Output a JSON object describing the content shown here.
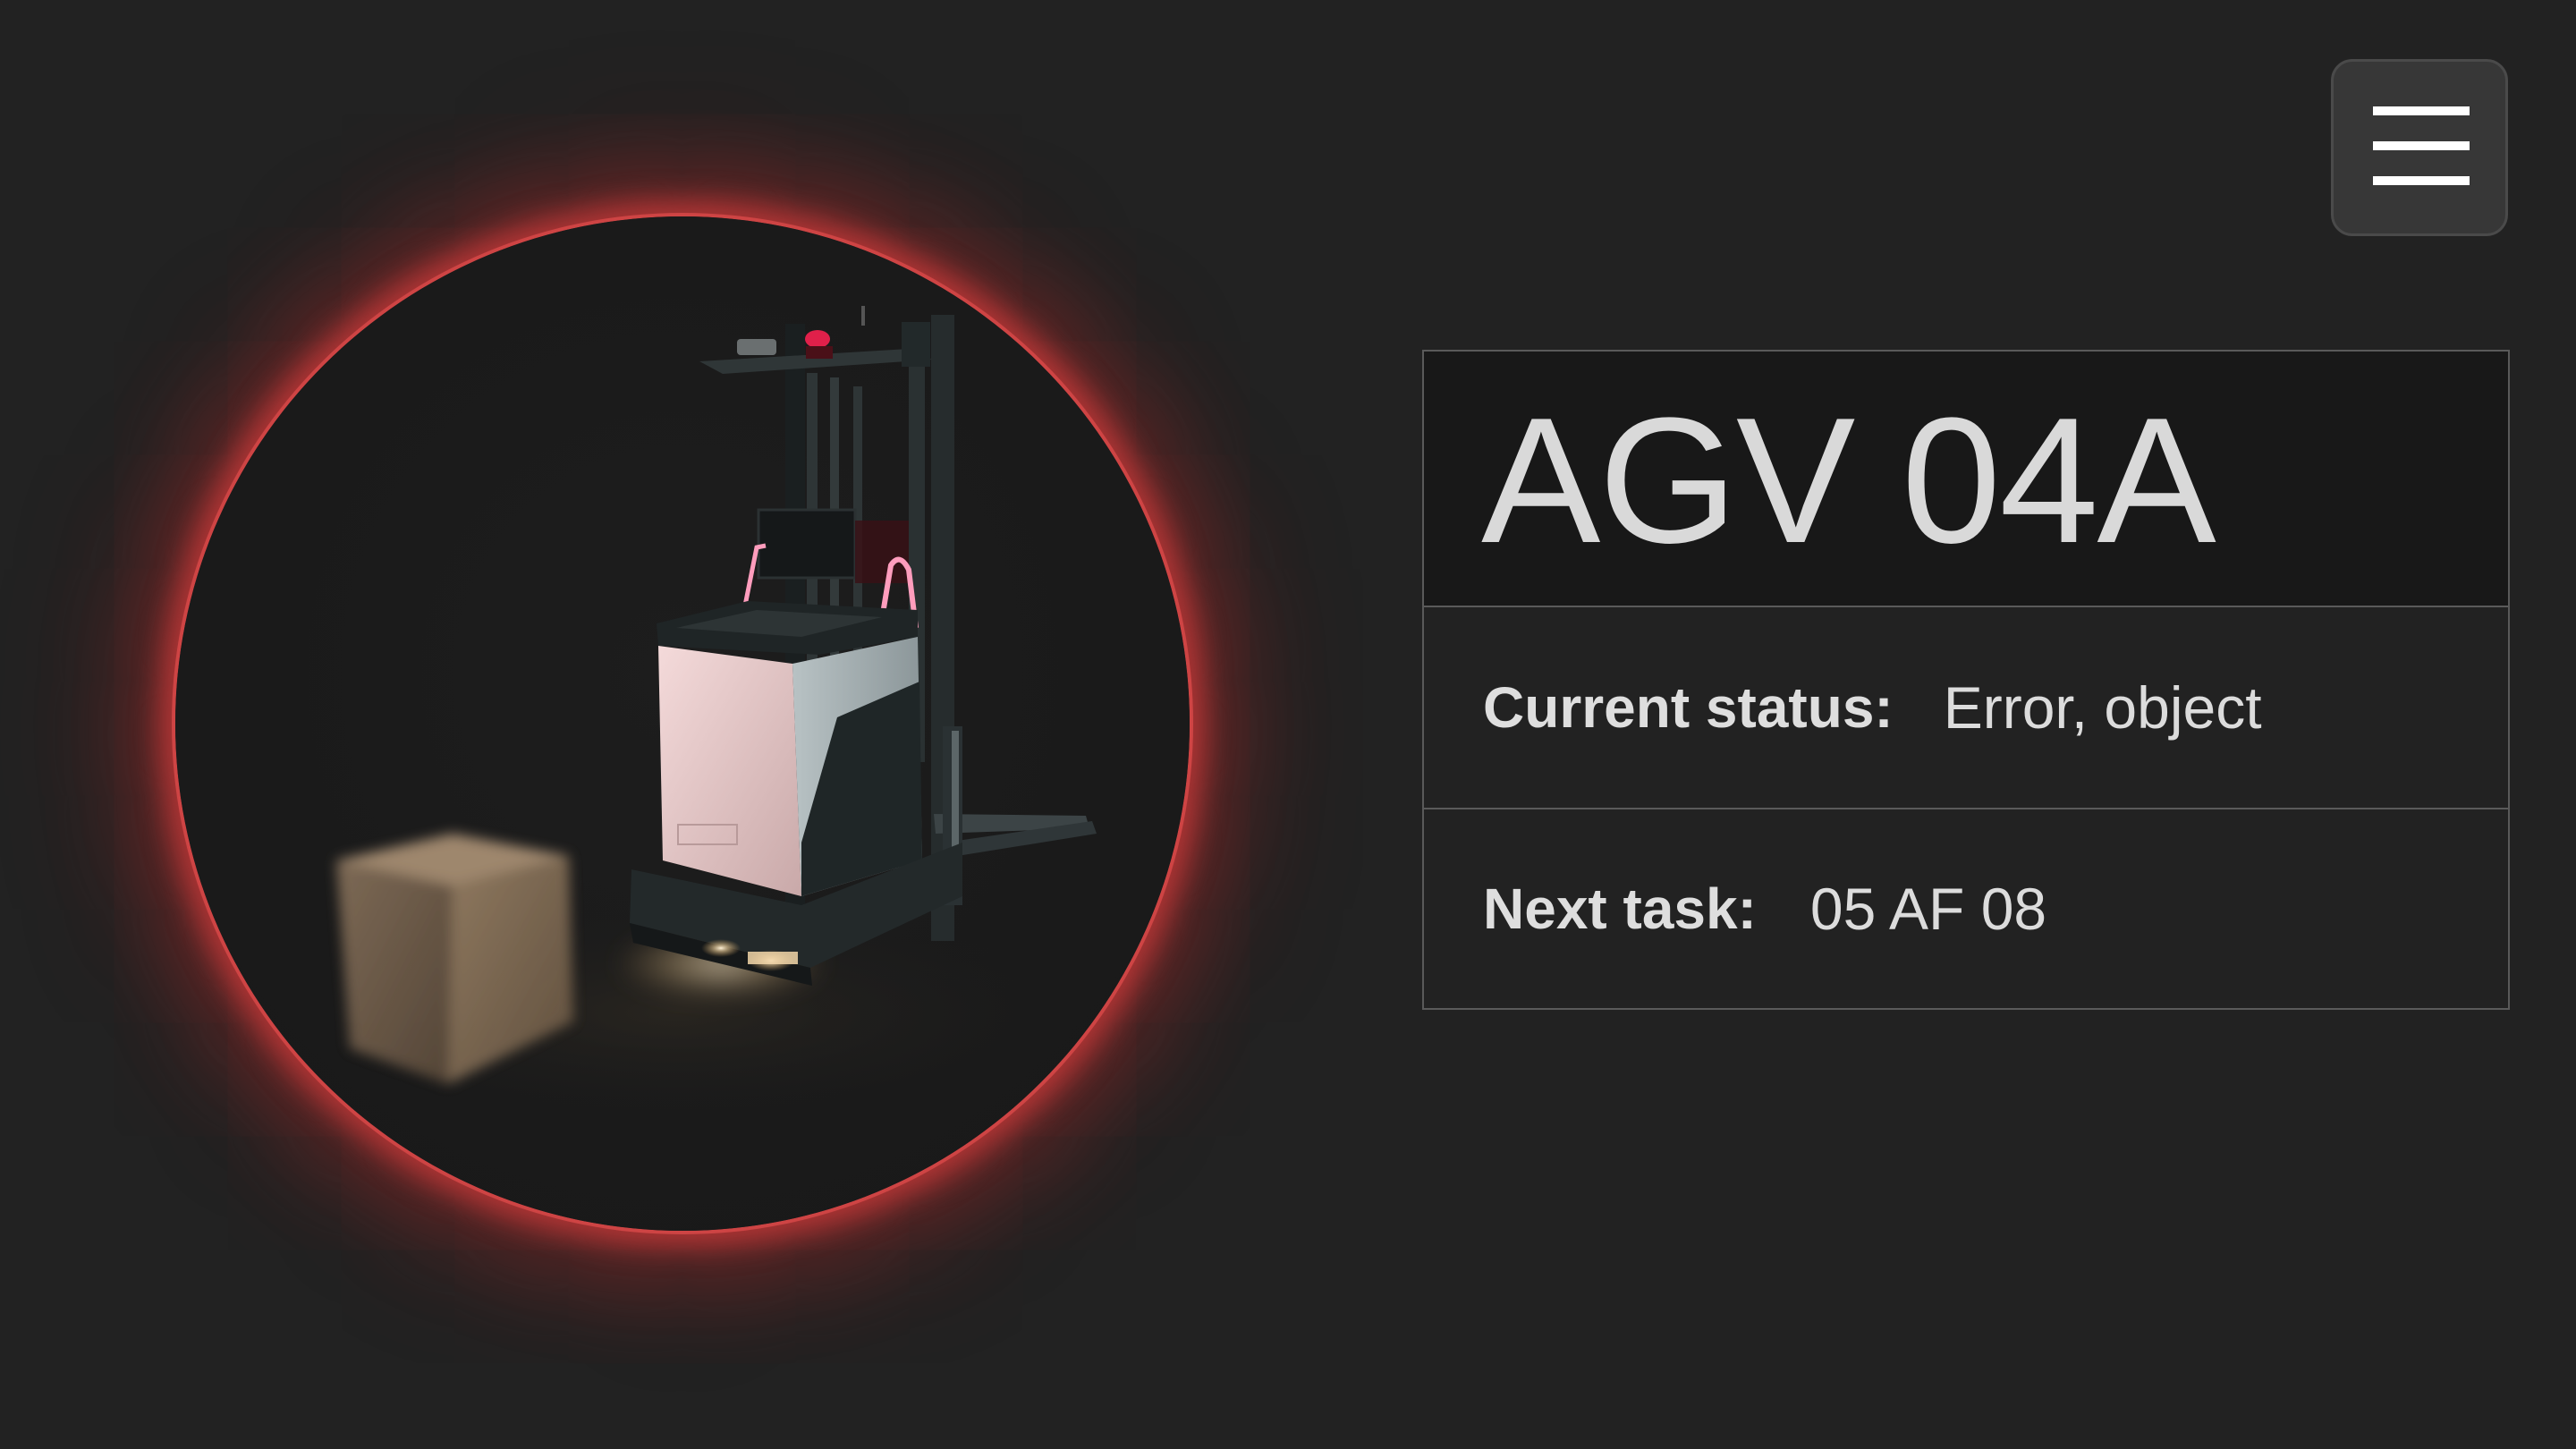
{
  "app": {
    "title": "AGV 04A"
  },
  "menu": {
    "icon": "hamburger-menu-icon"
  },
  "robot": {
    "image": "agv-forklift-render",
    "alert_ring_color": "#d64848"
  },
  "info": {
    "title": "AGV 04A",
    "status_label": "Current status:",
    "status_value": "Error, object",
    "task_label": "Next task:",
    "task_value": "05 AF 08"
  },
  "colors": {
    "background": "#222222",
    "panel_title_bg": "#181818",
    "border": "#5a5a5a",
    "text": "#d9d9d9",
    "alert": "#d64848"
  }
}
